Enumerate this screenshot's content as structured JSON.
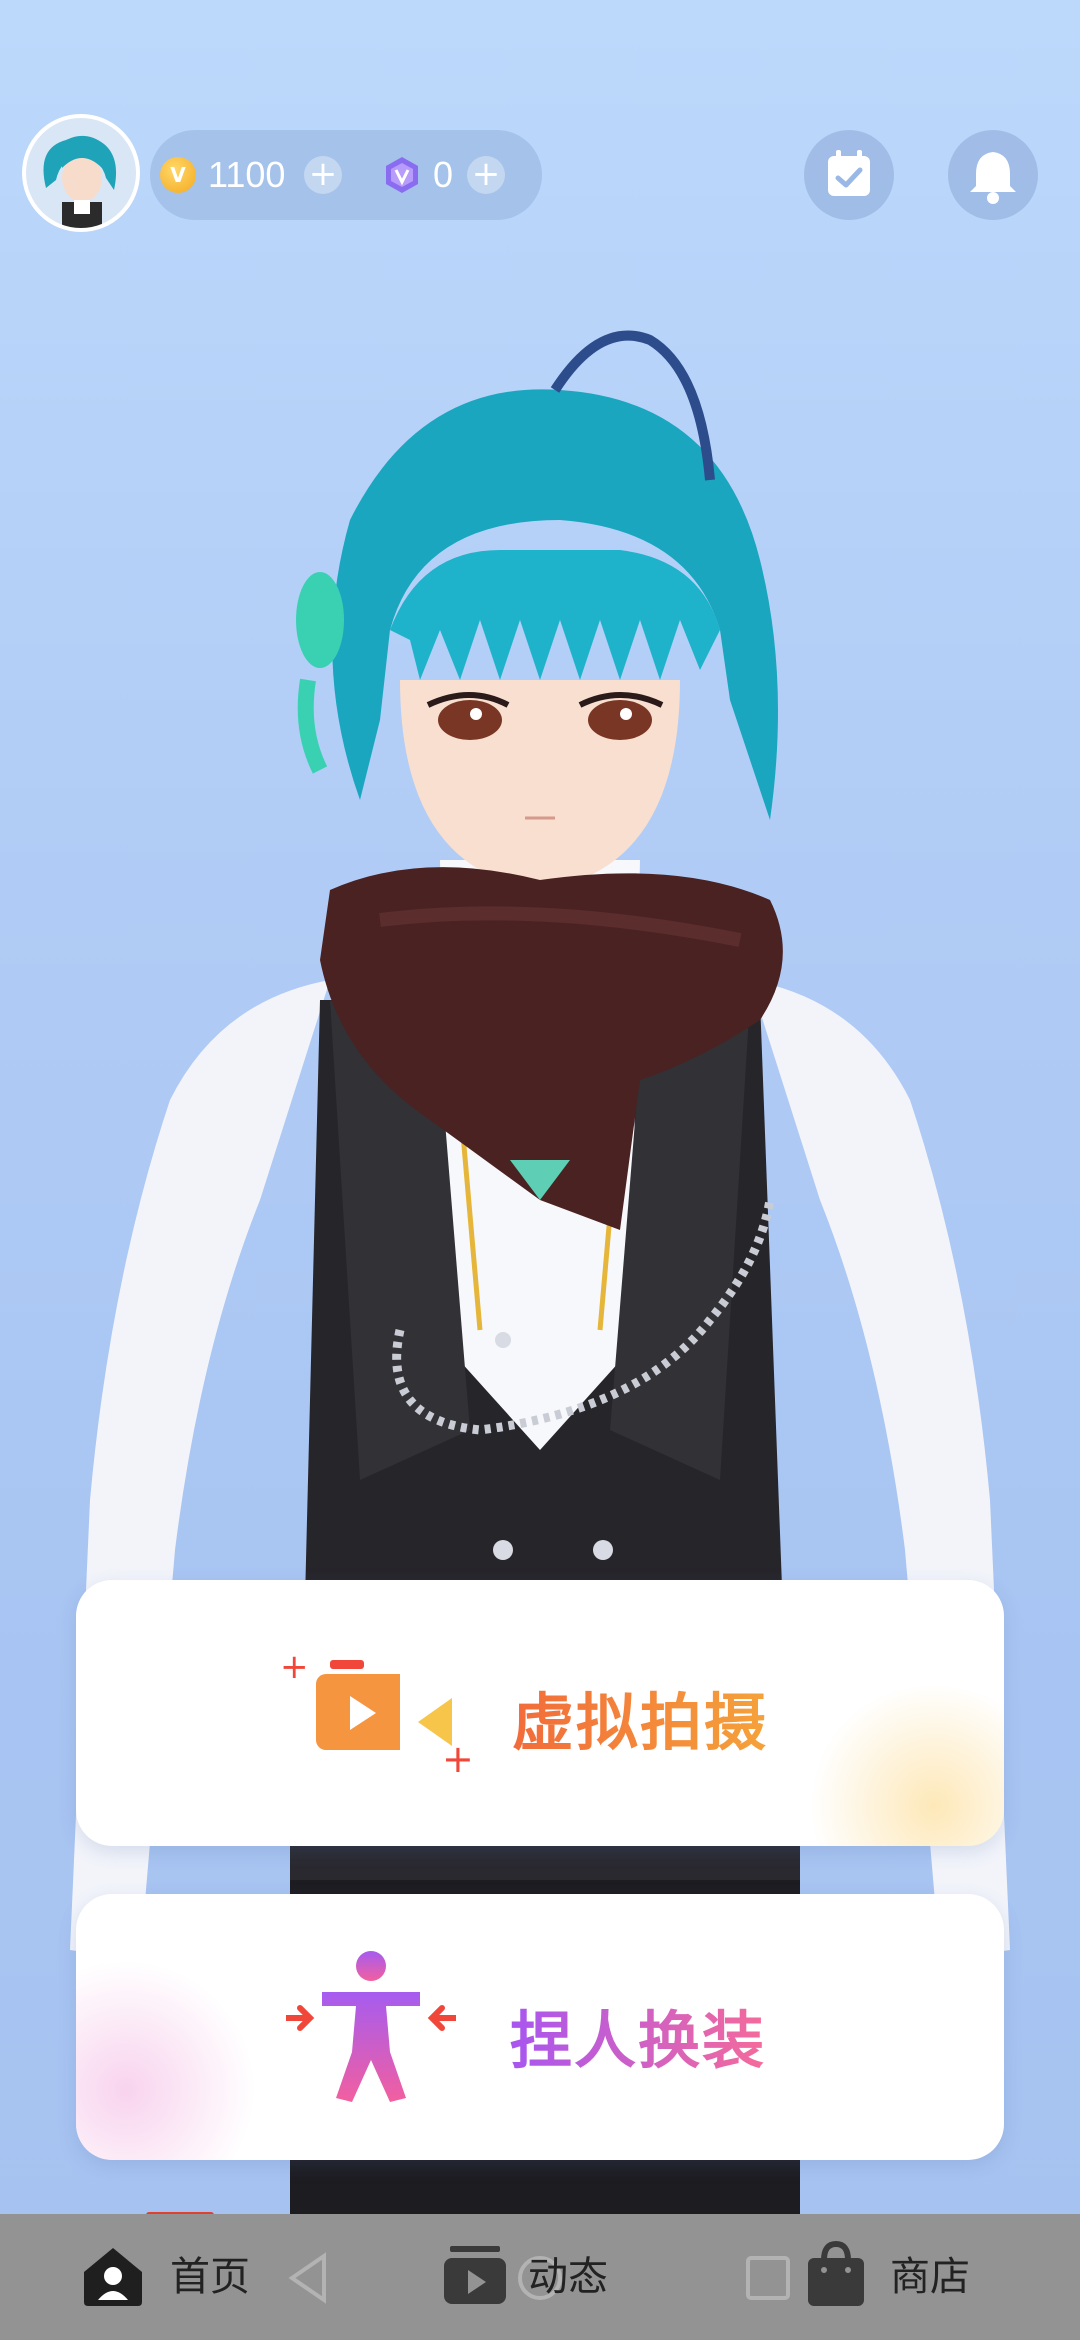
{
  "header": {
    "coins": "1100",
    "gems": "0",
    "coin_icon_letter": "V"
  },
  "cards": [
    {
      "label": "虚拟拍摄",
      "icon": "video-camera-icon"
    },
    {
      "label": "捏人换装",
      "icon": "body-stretch-icon"
    }
  ],
  "nav": {
    "items": [
      {
        "label": "首页",
        "icon": "home-icon",
        "active": true
      },
      {
        "label": "动态",
        "icon": "video-feed-icon",
        "active": false
      },
      {
        "label": "商店",
        "icon": "shopping-bag-icon",
        "active": false
      }
    ]
  },
  "colors": {
    "background": "#b1cdf6",
    "active_indicator": "#e0412f",
    "shoot_gradient": [
      "#f26b3a",
      "#f5a23a"
    ],
    "dress_gradient": [
      "#a856f0",
      "#f56a9a"
    ]
  }
}
